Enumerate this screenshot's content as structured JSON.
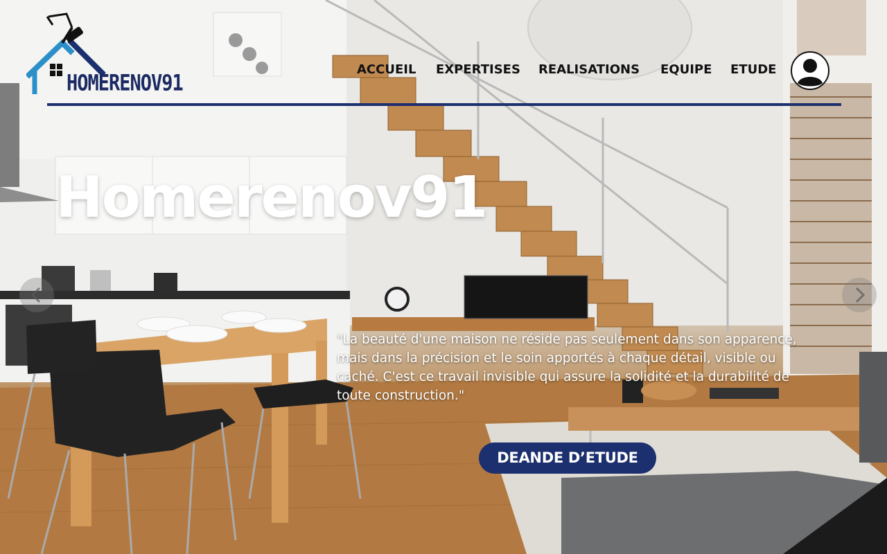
{
  "brand": {
    "name": "HOMERENOV91",
    "colors": {
      "navy": "#1c2f6e",
      "accent_blue": "#2b8fc9"
    }
  },
  "nav": {
    "items": [
      {
        "label": "ACCUEIL"
      },
      {
        "label": "EXPERTISES"
      },
      {
        "label": "REALISATIONS"
      },
      {
        "label": "EQUIPE"
      },
      {
        "label": "ETUDE"
      }
    ],
    "account_icon": "user-circle-icon"
  },
  "hero": {
    "title": "Homerenov91",
    "quote": "\"La beauté d'une maison ne réside pas seulement dans son apparence, mais dans la précision et le soin apportés à chaque détail, visible ou caché. C'est ce travail invisible qui assure la solidité et la durabilité de toute construction.\"",
    "cta_label": "DEANDE D’ETUDE"
  },
  "carousel": {
    "prev_icon": "chevron-left-icon",
    "next_icon": "chevron-right-icon"
  }
}
